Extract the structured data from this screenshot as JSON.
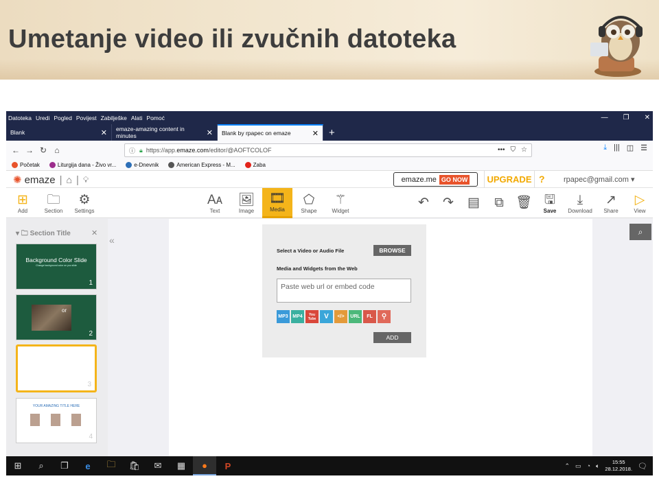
{
  "slide": {
    "title": "Umetanje video ili zvučnih datoteka"
  },
  "browser": {
    "menu": [
      "Datoteka",
      "Uredi",
      "Pogled",
      "Povijest",
      "Zabilješke",
      "Alati",
      "Pomoć"
    ],
    "tabs": [
      {
        "label": "Blank",
        "active": false
      },
      {
        "label": "emaze-amazing content in minutes",
        "active": false
      },
      {
        "label": "Blank by rpapec on emaze",
        "active": true
      }
    ],
    "url": "https://app.emaze.com/editor/@AOFTCOLOF",
    "url_prefix": "https://app.",
    "url_domain": "emaze.com",
    "url_path": "/editor/@AOFTCOLOF",
    "bookmarks": [
      {
        "label": "Početak",
        "color": "#e8532b"
      },
      {
        "label": "Liturgija dana - Živo vr...",
        "color": "#9c2d8c"
      },
      {
        "label": "e-Dnevnik",
        "color": "#2d6fb7"
      },
      {
        "label": "American Express - M...",
        "color": "#555555"
      },
      {
        "label": "Zaba",
        "color": "#e2231a"
      }
    ]
  },
  "emaze": {
    "logo": "emaze",
    "emaze_me": "emaze.me",
    "go_now": "GO NOW",
    "upgrade": "UPGRADE",
    "help": "?",
    "user": "rpapec@gmail.com ▾",
    "tools_left": [
      {
        "label": "Add"
      },
      {
        "label": "Section"
      },
      {
        "label": "Settings"
      }
    ],
    "tools_center": [
      {
        "label": "Text"
      },
      {
        "label": "Image"
      },
      {
        "label": "Media"
      },
      {
        "label": "Shape"
      },
      {
        "label": "Widget"
      }
    ],
    "tools_right": [
      {
        "label": "Save"
      },
      {
        "label": "Download"
      },
      {
        "label": "Share"
      },
      {
        "label": "View"
      }
    ],
    "section_title": "Section Title",
    "slides": [
      {
        "num": "1",
        "title": "Background Color Slide",
        "subtitle": "Change background color on you slide"
      },
      {
        "num": "2",
        "title": "or"
      },
      {
        "num": "3"
      },
      {
        "num": "4",
        "title": "YOUR AMAZING TITLE HERE"
      }
    ],
    "media_panel": {
      "select_label": "Select a Video or Audio File",
      "browse": "BROWSE",
      "web_label": "Media and Widgets from the Web",
      "placeholder": "Paste web url or embed code",
      "sources": [
        {
          "label": "MP3",
          "color": "#3a9ad9"
        },
        {
          "label": "MP4",
          "color": "#3ab0a0"
        },
        {
          "label": "You Tube",
          "color": "#d9473a"
        },
        {
          "label": "V",
          "color": "#3aa6d9"
        },
        {
          "label": "</>",
          "color": "#e39a3a"
        },
        {
          "label": "URL",
          "color": "#4cb87a"
        },
        {
          "label": "FL",
          "color": "#d9584a"
        },
        {
          "label": "⚲",
          "color": "#e0695a"
        }
      ],
      "add": "ADD"
    }
  },
  "taskbar": {
    "time": "15:55",
    "date": "28.12.2018."
  }
}
